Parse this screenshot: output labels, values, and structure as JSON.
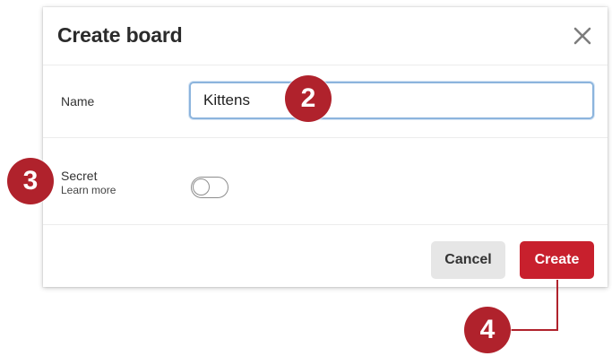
{
  "dialog": {
    "title": "Create board",
    "close_icon": "close-icon"
  },
  "name_field": {
    "label": "Name",
    "value": "Kittens"
  },
  "secret": {
    "label": "Secret",
    "learn_more": "Learn more",
    "enabled": false
  },
  "buttons": {
    "cancel": "Cancel",
    "create": "Create"
  },
  "callouts": {
    "name": "2",
    "secret": "3",
    "create": "4"
  },
  "colors": {
    "primary": "#c8202d",
    "callout": "#b0222c",
    "input_border": "#8cb4dd",
    "secondary_button": "#e6e6e6"
  }
}
